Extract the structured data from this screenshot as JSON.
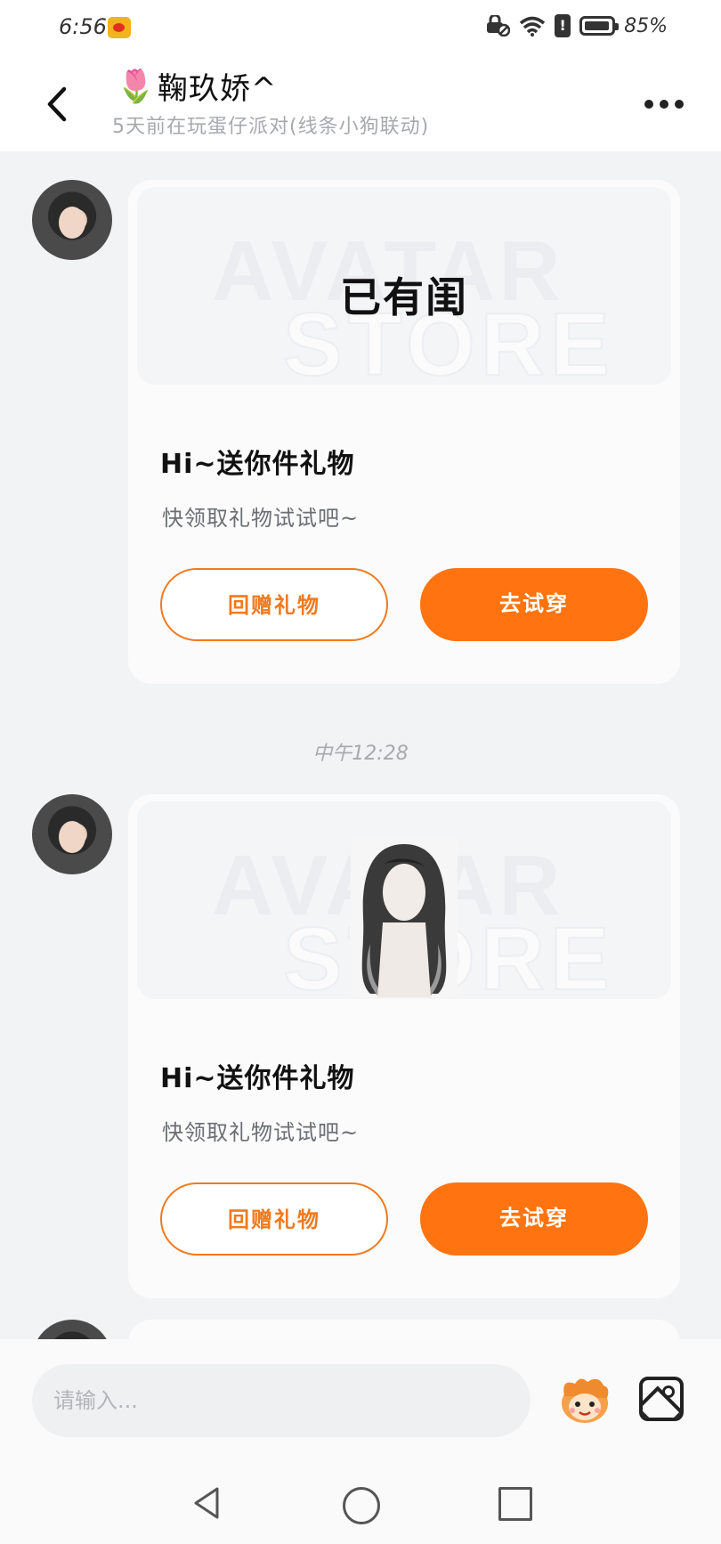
{
  "status_bar": {
    "time": "6:56",
    "battery": "85%",
    "icons": [
      "weibo-icon",
      "vpn-lock-icon",
      "wifi-icon",
      "alert-icon",
      "battery-icon"
    ]
  },
  "header": {
    "title_emoji": "🌷",
    "title": "鞠玖娇^",
    "subtitle": "5天前在玩蛋仔派对(线条小狗联动)"
  },
  "messages": [
    {
      "gift_status": "已有闺",
      "title": "Hi~送你件礼物",
      "subtitle": "快领取礼物试试吧~",
      "btn_return": "回赠礼物",
      "btn_try": "去试穿"
    },
    {
      "gift_status": "",
      "title": "Hi~送你件礼物",
      "subtitle": "快领取礼物试试吧~",
      "btn_return": "回赠礼物",
      "btn_try": "去试穿"
    }
  ],
  "timestamp": "中午12:28",
  "input": {
    "placeholder": "请输入..."
  },
  "colors": {
    "accent": "#ff7410",
    "accent_outline": "#f07a1e",
    "background": "#f2f3f5",
    "card": "#fbfbfc"
  }
}
